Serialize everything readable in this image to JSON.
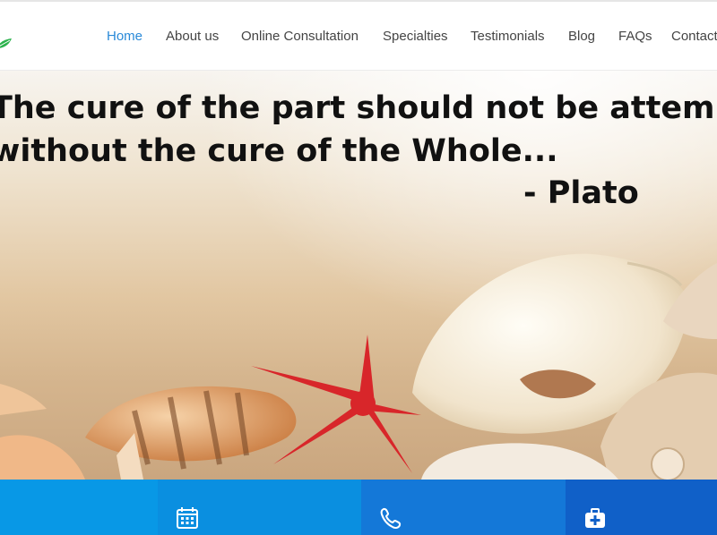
{
  "nav": {
    "items": [
      {
        "label": "Home",
        "active": true
      },
      {
        "label": "About us"
      },
      {
        "label": "Online Consultation"
      },
      {
        "label": "Specialties"
      },
      {
        "label": "Testimonials"
      },
      {
        "label": "Blog"
      },
      {
        "label": "FAQs"
      },
      {
        "label": "Contact"
      }
    ]
  },
  "hero": {
    "quote_line1": "The cure of the part should not be attempted",
    "quote_line2": "without the cure of the Whole...",
    "quote_author": "- Plato"
  },
  "features": [
    {
      "icon": "calendar-icon",
      "color": "#0898e6"
    },
    {
      "icon": "phone-icon",
      "color": "#1478d8"
    },
    {
      "icon": "medical-kit-icon",
      "color": "#1060c8"
    }
  ],
  "colors": {
    "nav_active": "#2a8ad8",
    "nav_text": "#444444",
    "logo_green": "#2bb24c"
  }
}
